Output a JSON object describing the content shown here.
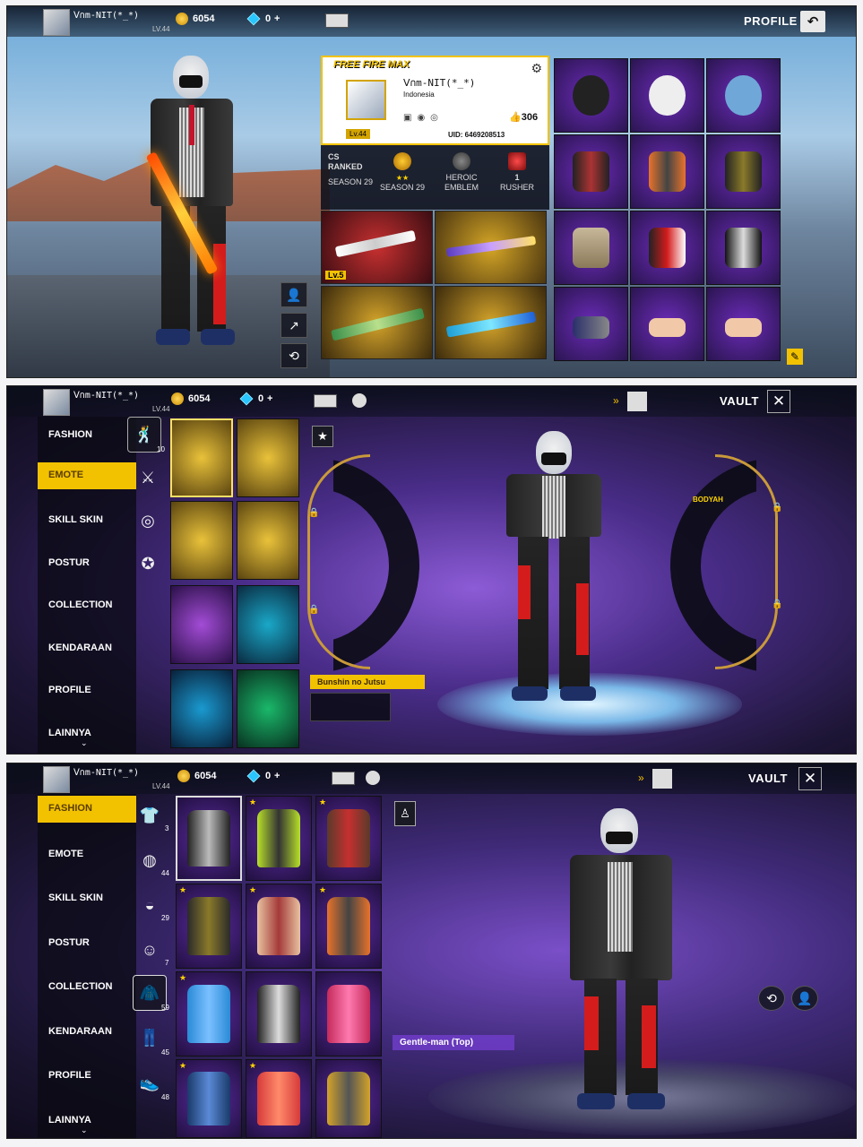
{
  "player": {
    "name": "ᐯ∩m-NIT(*_*)",
    "level": "LV.44"
  },
  "currency": {
    "coins": "6054",
    "diamonds": "0",
    "plus": "+"
  },
  "screen1": {
    "title": "PROFILE",
    "back_icon": "back-arrow-icon",
    "card": {
      "brand": "FREE FIRE MAX",
      "country": "Indonesia",
      "level": "Lv.44",
      "likes": "306",
      "uid": "UID: 6469208513"
    },
    "badges": [
      {
        "top": "CS",
        "mid": "RANKED",
        "bottom": "SEASON 29"
      },
      {
        "top": "",
        "mid": "",
        "bottom": "SEASON 29"
      },
      {
        "top": "",
        "mid": "HEROIC",
        "bottom": "EMBLEM"
      },
      {
        "top": "",
        "mid": "1",
        "bottom": "RUSHER"
      }
    ],
    "weapon_level": "Lv.5"
  },
  "screen2": {
    "title": "VAULT",
    "menu": [
      "FASHION",
      "EMOTE",
      "SKILL SKIN",
      "POSTUR",
      "COLLECTION",
      "KENDARAAN",
      "PROFILE",
      "LAINNYA"
    ],
    "active": "EMOTE",
    "fashion_count": "10",
    "selected_emote": "Bunshin no Jutsu",
    "wheel_label": "BODYAH"
  },
  "screen3": {
    "title": "VAULT",
    "menu": [
      "FASHION",
      "EMOTE",
      "SKILL SKIN",
      "POSTUR",
      "COLLECTION",
      "KENDARAAN",
      "PROFILE",
      "LAINNYA"
    ],
    "active": "FASHION",
    "counts": [
      "3",
      "44",
      "29",
      "7",
      "59",
      "45",
      "48"
    ],
    "selected_item": "Gentle-man (Top)"
  }
}
